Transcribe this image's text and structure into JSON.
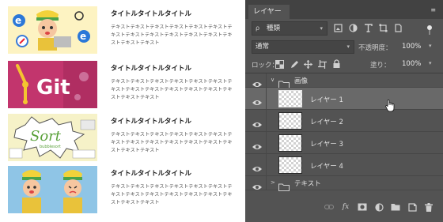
{
  "articles": [
    {
      "title": "タイトルタイトルタイトル",
      "body": "テキストテキストテキストテキストテキストテキストテキストテキストテキストテキストテキストテキストテキストテキストテキスト",
      "thumb": "browser-mascot",
      "bg": "#fdf3c2"
    },
    {
      "title": "タイトルタイトルタイトル",
      "body": "テキストテキストテキストテキストテキストテキストテキストテキストテキストテキストテキストテキストテキストテキストテキスト",
      "thumb": "git",
      "thumb_text": "Git",
      "bg": "#c2356d"
    },
    {
      "title": "タイトルタイトルタイトル",
      "body": "テキストテキストテキストテキストテキストテキストテキストテキストテキストテキストテキストテキストテキストテキストテキスト",
      "thumb": "sort",
      "thumb_text": "Sort",
      "thumb_sub": "bubblesort",
      "bg": "#f6f2c8"
    },
    {
      "title": "タイトルタイトルタイトル",
      "body": "テキストテキストテキストテキストテキストテキストテキストテキストテキストテキストテキストテキストテキストテキストテキスト",
      "thumb": "mascots",
      "bg": "#8fc5e6"
    }
  ],
  "panel": {
    "tab_label": "レイヤー",
    "kind_prefix": "ρ",
    "kind_value": "種類",
    "blend_mode": "通常",
    "opacity_label": "不透明度：",
    "opacity_value": "100%",
    "lock_label": "ロック：",
    "fill_label": "塗り：",
    "fill_value": "100%",
    "layers": [
      {
        "type": "group",
        "name": "画像",
        "expanded": true
      },
      {
        "type": "layer",
        "name": "レイヤー 1",
        "selected": true
      },
      {
        "type": "layer",
        "name": "レイヤー 2"
      },
      {
        "type": "layer",
        "name": "レイヤー 3"
      },
      {
        "type": "layer",
        "name": "レイヤー 4"
      },
      {
        "type": "group",
        "name": "テキスト",
        "expanded": false
      }
    ],
    "bottom_icons": [
      "link-icon",
      "fx-icon",
      "mask-icon",
      "adjustment-icon",
      "folder-icon",
      "new-layer-icon",
      "trash-icon"
    ]
  }
}
